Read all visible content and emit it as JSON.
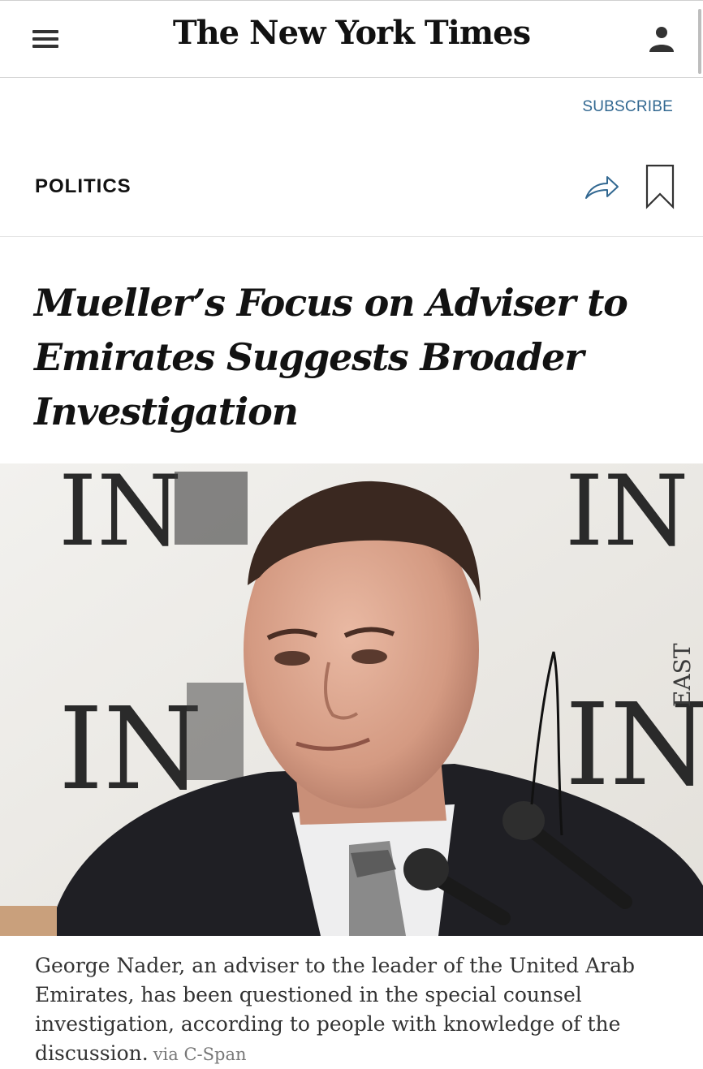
{
  "header": {
    "logo": "The New York Times",
    "menu_icon": "hamburger-menu-icon",
    "account_icon": "user-account-icon"
  },
  "subscribe_label": "SUBSCRIBE",
  "section": {
    "label": "POLITICS",
    "share_icon": "share-arrow-icon",
    "bookmark_icon": "bookmark-icon"
  },
  "article": {
    "headline": "Mueller’s Focus on Adviser to Emirates Suggests Broader Investigation",
    "image": {
      "backdrop_text": [
        "IN",
        "IN",
        "IN",
        "IN",
        "EAST"
      ]
    },
    "caption": "George Nader, an adviser to the leader of the United Arab Emirates, has been questioned in the special counsel investigation, according to people with knowledge of the discussion.",
    "credit": "via C-Span"
  },
  "colors": {
    "link": "#326891",
    "text": "#121212",
    "caption": "#333333"
  }
}
